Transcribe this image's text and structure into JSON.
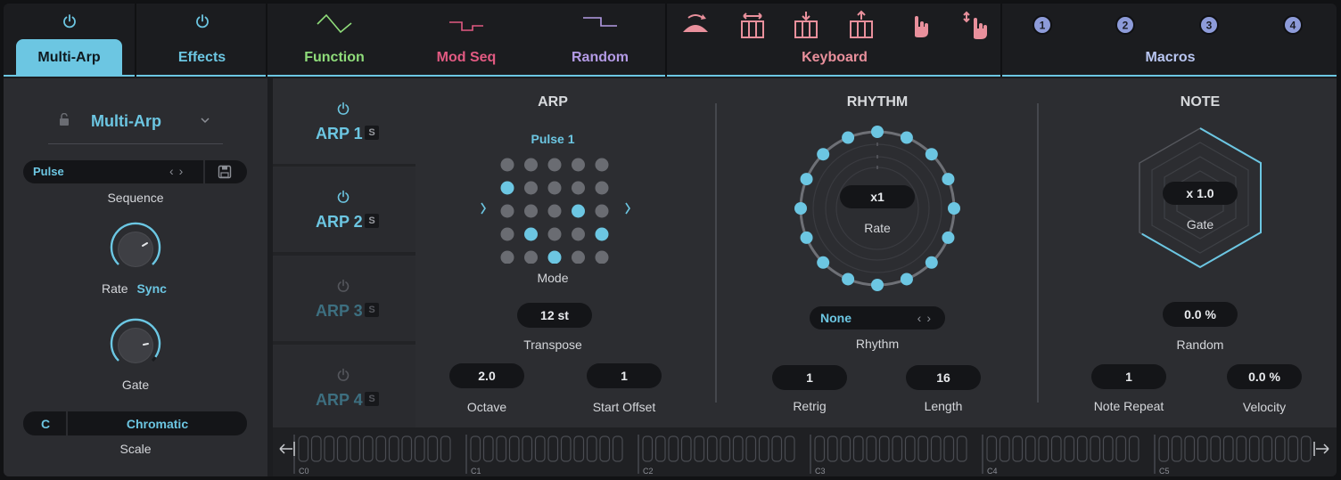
{
  "tabs": {
    "multi_arp": "Multi-Arp",
    "effects": "Effects",
    "function": "Function",
    "mod_seq": "Mod Seq",
    "random": "Random",
    "keyboard": "Keyboard",
    "macros": "Macros"
  },
  "macros": [
    "1",
    "2",
    "3",
    "4"
  ],
  "colors": {
    "accent": "#6cc6e2",
    "function": "#8fdc7a",
    "mod_seq": "#e25a82",
    "random": "#b49be6",
    "keyboard": "#e9909c",
    "macros": "#b9c6f2"
  },
  "left": {
    "preset_name": "Multi-Arp",
    "sequence_value": "Pulse",
    "sequence_label": "Sequence",
    "rate_label": "Rate",
    "rate_mode": "Sync",
    "gate_label": "Gate",
    "scale_key": "C",
    "scale_name": "Chromatic",
    "scale_label": "Scale"
  },
  "arps": [
    {
      "label": "ARP 1",
      "solo": "S",
      "active": true
    },
    {
      "label": "ARP 2",
      "solo": "S",
      "active": true
    },
    {
      "label": "ARP 3",
      "solo": "S",
      "active": false
    },
    {
      "label": "ARP 4",
      "solo": "S",
      "active": false
    }
  ],
  "arp": {
    "title": "ARP",
    "pattern_name": "Pulse 1",
    "mode_label": "Mode",
    "transpose_value": "12 st",
    "transpose_label": "Transpose",
    "octave_value": "2.0",
    "octave_label": "Octave",
    "start_offset_value": "1",
    "start_offset_label": "Start Offset"
  },
  "rhythm": {
    "title": "RHYTHM",
    "rate_value": "x1",
    "rate_label": "Rate",
    "rhythm_value": "None",
    "rhythm_label": "Rhythm",
    "retrig_value": "1",
    "retrig_label": "Retrig",
    "length_value": "16",
    "length_label": "Length"
  },
  "note": {
    "title": "NOTE",
    "gate_value": "x 1.0",
    "gate_label": "Gate",
    "random_value": "0.0 %",
    "random_label": "Random",
    "note_repeat_value": "1",
    "note_repeat_label": "Note Repeat",
    "velocity_value": "0.0 %",
    "velocity_label": "Velocity"
  },
  "keyboard_strip": {
    "octaves": [
      "C0",
      "C1",
      "C2",
      "C3",
      "C4",
      "C5"
    ]
  }
}
